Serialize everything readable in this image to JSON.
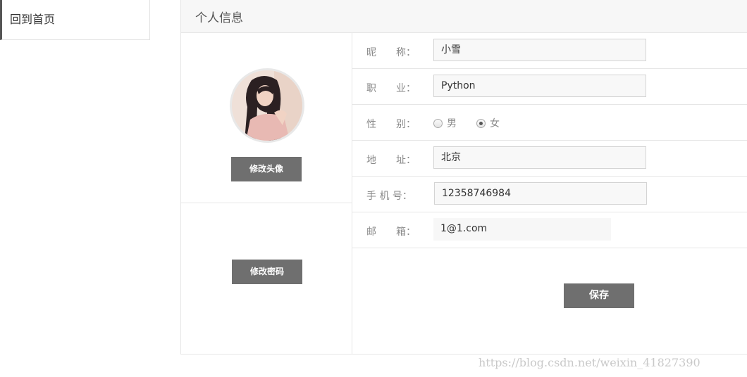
{
  "sidebar": {
    "items": [
      {
        "label": "回到首页"
      }
    ]
  },
  "panel": {
    "title": "个人信息"
  },
  "avatar_section": {
    "change_avatar_label": "修改头像"
  },
  "password_section": {
    "change_password_label": "修改密码"
  },
  "form": {
    "nickname": {
      "label": "昵　　称：",
      "value": "小雪"
    },
    "job": {
      "label": "职　　业：",
      "value": "Python"
    },
    "gender": {
      "label": "性　　别：",
      "options": [
        {
          "label": "男",
          "checked": false
        },
        {
          "label": "女",
          "checked": true
        }
      ]
    },
    "address": {
      "label": "地　　址：",
      "value": "北京"
    },
    "phone": {
      "label": "手 机 号：",
      "value": "12358746984"
    },
    "email": {
      "label": "邮　　箱：",
      "value": "1@1.com"
    },
    "save_label": "保存"
  },
  "watermark": "https://blog.csdn.net/weixin_41827390",
  "colors": {
    "button": "#6f6f6f",
    "border": "#e6e6e6",
    "header_bg": "#f7f7f7"
  }
}
